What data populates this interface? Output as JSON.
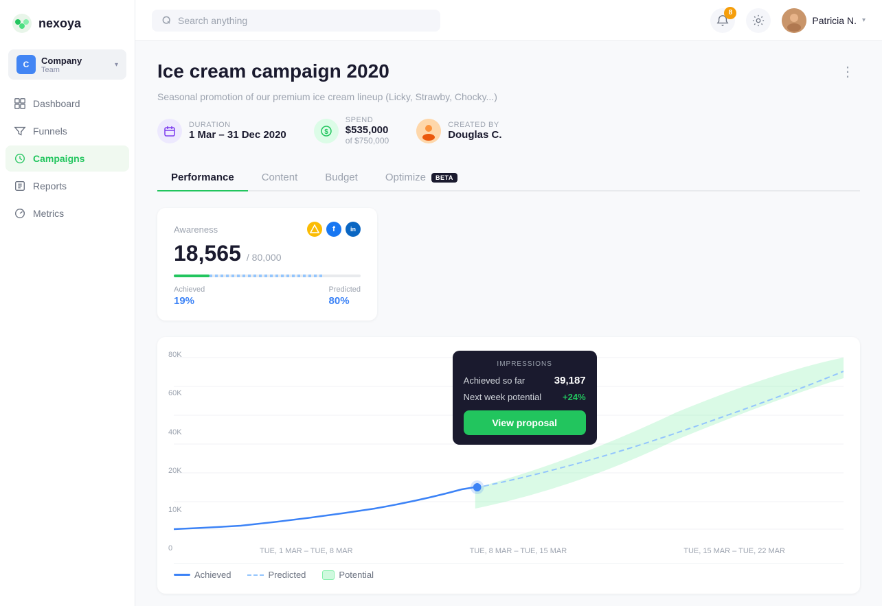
{
  "app": {
    "name": "nexoya",
    "search_placeholder": "Search anything"
  },
  "company": {
    "name": "Company",
    "team": "Team"
  },
  "nav": {
    "items": [
      {
        "id": "dashboard",
        "label": "Dashboard",
        "active": false
      },
      {
        "id": "funnels",
        "label": "Funnels",
        "active": false
      },
      {
        "id": "campaigns",
        "label": "Campaigns",
        "active": true
      },
      {
        "id": "reports",
        "label": "Reports",
        "active": false
      },
      {
        "id": "metrics",
        "label": "Metrics",
        "active": false
      }
    ]
  },
  "topbar": {
    "notifications_count": "8",
    "user_name": "Patricia N."
  },
  "campaign": {
    "title": "Ice cream campaign 2020",
    "subtitle": "Seasonal promotion of our premium ice cream lineup (Licky, Strawby, Chocky...)",
    "duration_label": "Duration",
    "duration_value": "1 Mar – 31 Dec 2020",
    "spend_label": "Spend",
    "spend_value": "$535,000",
    "spend_of": "of $750,000",
    "created_label": "Created by",
    "created_value": "Douglas C."
  },
  "tabs": [
    {
      "id": "performance",
      "label": "Performance",
      "active": true,
      "badge": null
    },
    {
      "id": "content",
      "label": "Content",
      "active": false,
      "badge": null
    },
    {
      "id": "budget",
      "label": "Budget",
      "active": false,
      "badge": null
    },
    {
      "id": "optimize",
      "label": "Optimize",
      "active": false,
      "badge": "BETA"
    }
  ],
  "awareness": {
    "label": "Awareness",
    "value": "18,565",
    "total": "/ 80,000",
    "achieved_label": "Achieved",
    "achieved_value": "19%",
    "predicted_label": "Predicted",
    "predicted_value": "80%"
  },
  "chart": {
    "title": "IMPRESSIONS",
    "achieved_label": "Achieved so far",
    "achieved_value": "39,187",
    "next_week_label": "Next week potential",
    "next_week_value": "+24%",
    "view_proposal_btn": "View proposal",
    "y_labels": [
      "80K",
      "60K",
      "40K",
      "20K",
      "10K",
      "0"
    ],
    "x_labels": [
      "TUE, 1 MAR – TUE, 8 MAR",
      "TUE, 8 MAR – TUE, 15 MAR",
      "TUE, 15 MAR – TUE, 22 MAR"
    ]
  },
  "legend": {
    "achieved": "Achieved",
    "predicted": "Predicted",
    "potential": "Potential"
  },
  "platforms": [
    {
      "id": "google",
      "color": "#fbbc04",
      "label": "G"
    },
    {
      "id": "facebook",
      "color": "#1877f2",
      "label": "f"
    },
    {
      "id": "linkedin",
      "color": "#0a66c2",
      "label": "in"
    }
  ]
}
